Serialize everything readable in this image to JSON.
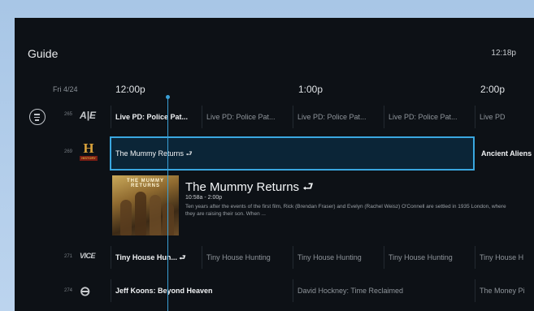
{
  "header": {
    "title": "Guide",
    "clock": "12:18p"
  },
  "timeline": {
    "date": "Fri 4/24",
    "times": [
      "12:00p",
      "1:00p",
      "2:00p"
    ]
  },
  "rows": [
    {
      "channel_number": "265",
      "channel_logo": "A|E",
      "programs": [
        {
          "title": "Live PD: Police Pat..."
        },
        {
          "title": "Live PD: Police Pat..."
        },
        {
          "title": "Live PD: Police Pat..."
        },
        {
          "title": "Live PD: Police Pat..."
        },
        {
          "title": "Live PD"
        }
      ]
    },
    {
      "channel_number": "269",
      "channel_logo": "H",
      "channel_logo_sub": "HISTORY",
      "programs": [
        {
          "title": "The Mummy Returns ⮐"
        },
        {
          "title": "Ancient Aliens"
        }
      ]
    },
    {
      "channel_number": "271",
      "channel_logo": "VICE",
      "programs": [
        {
          "title": "Tiny House Hun... ⮐"
        },
        {
          "title": "Tiny House Hunting"
        },
        {
          "title": "Tiny House Hunting"
        },
        {
          "title": "Tiny House Hunting"
        },
        {
          "title": "Tiny House H"
        }
      ]
    },
    {
      "channel_number": "274",
      "channel_logo": "⊖",
      "programs": [
        {
          "title": "Jeff Koons: Beyond Heaven"
        },
        {
          "title": "David Hockney: Time Reclaimed"
        },
        {
          "title": "The Money Pi"
        }
      ]
    }
  ],
  "detail": {
    "poster_text": "THE MUMMY RETURNS",
    "title": "The Mummy Returns ⮐",
    "time": "10:58a - 2:00p",
    "description": "Ten years after the events of the first film, Rick (Brendan Fraser) and Evelyn (Rachel Weisz) O'Connell are settled in 1935 London, where they are raising their son. When ..."
  },
  "colors": {
    "accent": "#3aa7e0",
    "background": "#0d1116",
    "selected_fill": "#0b2537"
  }
}
